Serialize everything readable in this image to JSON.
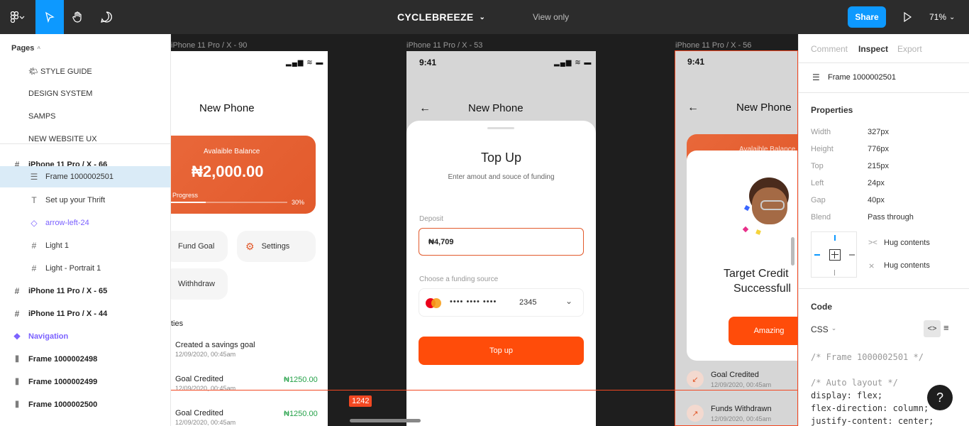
{
  "toolbar": {
    "title": "CYCLEBREEZE",
    "view_only": "View only",
    "share": "Share",
    "zoom": "71%"
  },
  "pages": {
    "header": "Pages",
    "items": [
      "🌤 STYLE GUIDE",
      "DESIGN SYSTEM",
      "SAMPS",
      "NEW WEBSITE UX"
    ]
  },
  "layers": [
    {
      "label": "iPhone 11 Pro / X - 66",
      "icon": "#"
    },
    {
      "label": "Frame 1000002501",
      "icon": "☰"
    },
    {
      "label": "Set up your Thrift",
      "icon": "T"
    },
    {
      "label": "arrow-left-24",
      "icon": "◇"
    },
    {
      "label": "Light 1",
      "icon": "#"
    },
    {
      "label": "Light - Portrait 1",
      "icon": "#"
    },
    {
      "label": "iPhone 11 Pro / X - 65",
      "icon": "#"
    },
    {
      "label": "iPhone 11 Pro / X - 44",
      "icon": "#"
    },
    {
      "label": "Navigation",
      "icon": "❖"
    },
    {
      "label": "Frame 1000002498",
      "icon": "⫴"
    },
    {
      "label": "Frame 1000002499",
      "icon": "⫴"
    },
    {
      "label": "Frame 1000002500",
      "icon": "⫴"
    }
  ],
  "canvas": {
    "frames": [
      {
        "label": "iPhone 11 Pro / X - 90"
      },
      {
        "label": "iPhone 11 Pro / X - 53"
      },
      {
        "label": "iPhone 11 Pro / X - 56"
      }
    ],
    "measure": "1242",
    "phone1": {
      "title": "New Phone",
      "balance_label": "Avalaible Balance",
      "balance": "₦2,000.00",
      "progress_label": "Progress",
      "progress_pct": "30%",
      "progress": 0.3,
      "fund_goal": "Fund Goal",
      "settings": "Settings",
      "withdraw": "Withhdraw",
      "activities_header": "ties",
      "activities": [
        {
          "title": "Created a savings goal",
          "date": "12/09/2020, 00:45am",
          "amount": ""
        },
        {
          "title": "Goal Credited",
          "date": "12/09/2020, 00:45am",
          "amount": "₦1250.00"
        },
        {
          "title": "Goal Credited",
          "date": "12/09/2020, 00:45am",
          "amount": "₦1250.00"
        }
      ]
    },
    "phone2": {
      "time": "9:41",
      "title": "New Phone",
      "sheet_title": "Top Up",
      "sheet_subtitle": "Enter amout and souce of funding",
      "deposit_label": "Deposit",
      "deposit_value": "₦4,709",
      "funding_label": "Choose a funding source",
      "card_mask": "••••   ••••   ••••",
      "card_last": "2345",
      "button": "Top up"
    },
    "phone3": {
      "time": "9:41",
      "title": "New Phone",
      "balance_label": "Avalaible Balance",
      "modal_title_1": "Target Credit",
      "modal_title_2": "Successfull",
      "button": "Amazing",
      "activities": [
        {
          "title": "Goal Credited",
          "date": "12/09/2020, 00:45am"
        },
        {
          "title": "Funds Withdrawn",
          "date": "12/09/2020, 00:45am"
        }
      ]
    }
  },
  "inspect": {
    "tabs": [
      "Comment",
      "Inspect",
      "Export"
    ],
    "frame_name": "Frame 1000002501",
    "properties_header": "Properties",
    "properties": [
      {
        "label": "Width",
        "value": "327px"
      },
      {
        "label": "Height",
        "value": "776px"
      },
      {
        "label": "Top",
        "value": "215px"
      },
      {
        "label": "Left",
        "value": "24px"
      },
      {
        "label": "Gap",
        "value": "40px"
      },
      {
        "label": "Blend",
        "value": "Pass through"
      }
    ],
    "hug_1": "Hug contents",
    "hug_2": "Hug contents",
    "code_header": "Code",
    "code_lang": "CSS",
    "code_lines": [
      {
        "text": "/* Frame 1000002501 */",
        "comment": true
      },
      {
        "text": "/* Auto layout */",
        "comment": true
      },
      {
        "text": "display: flex;",
        "comment": false
      },
      {
        "text": "flex-direction: column;",
        "comment": false
      },
      {
        "text": "justify-content: center;",
        "comment": false
      }
    ],
    "help": "?"
  },
  "colors": {
    "accent": "#0d99ff",
    "brand_orange": "#ff4c0a",
    "success": "#24a148"
  }
}
